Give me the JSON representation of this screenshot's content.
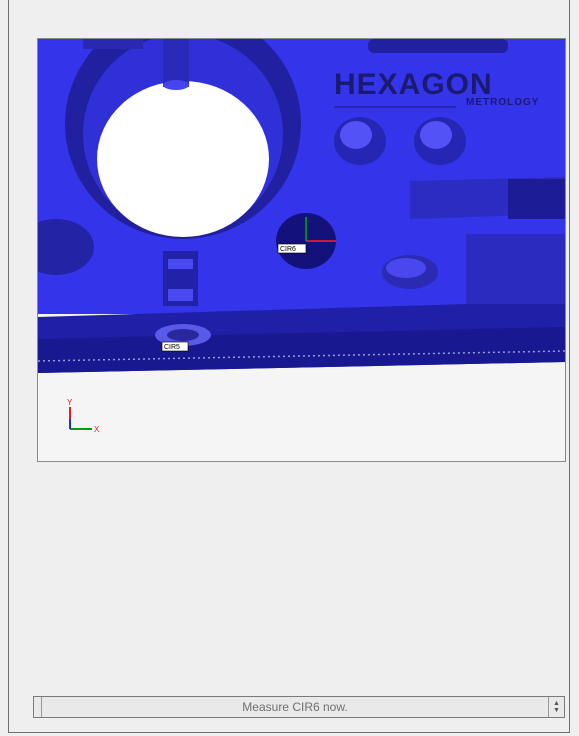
{
  "viewport": {
    "logo_text": "HEXAGON",
    "logo_subtext": "METROLOGY",
    "feature_labels": [
      "CIR6",
      "CIR5"
    ],
    "axis_labels": {
      "x": "X",
      "y": "Y"
    },
    "colors": {
      "part_blue": "#3131e6",
      "part_dark": "#1a1a8c",
      "background": "#f5f5f5"
    }
  },
  "status": {
    "message": "Measure CIR6 now.",
    "spin_up_icon": "chevron-up-icon",
    "spin_down_icon": "chevron-down-icon"
  }
}
